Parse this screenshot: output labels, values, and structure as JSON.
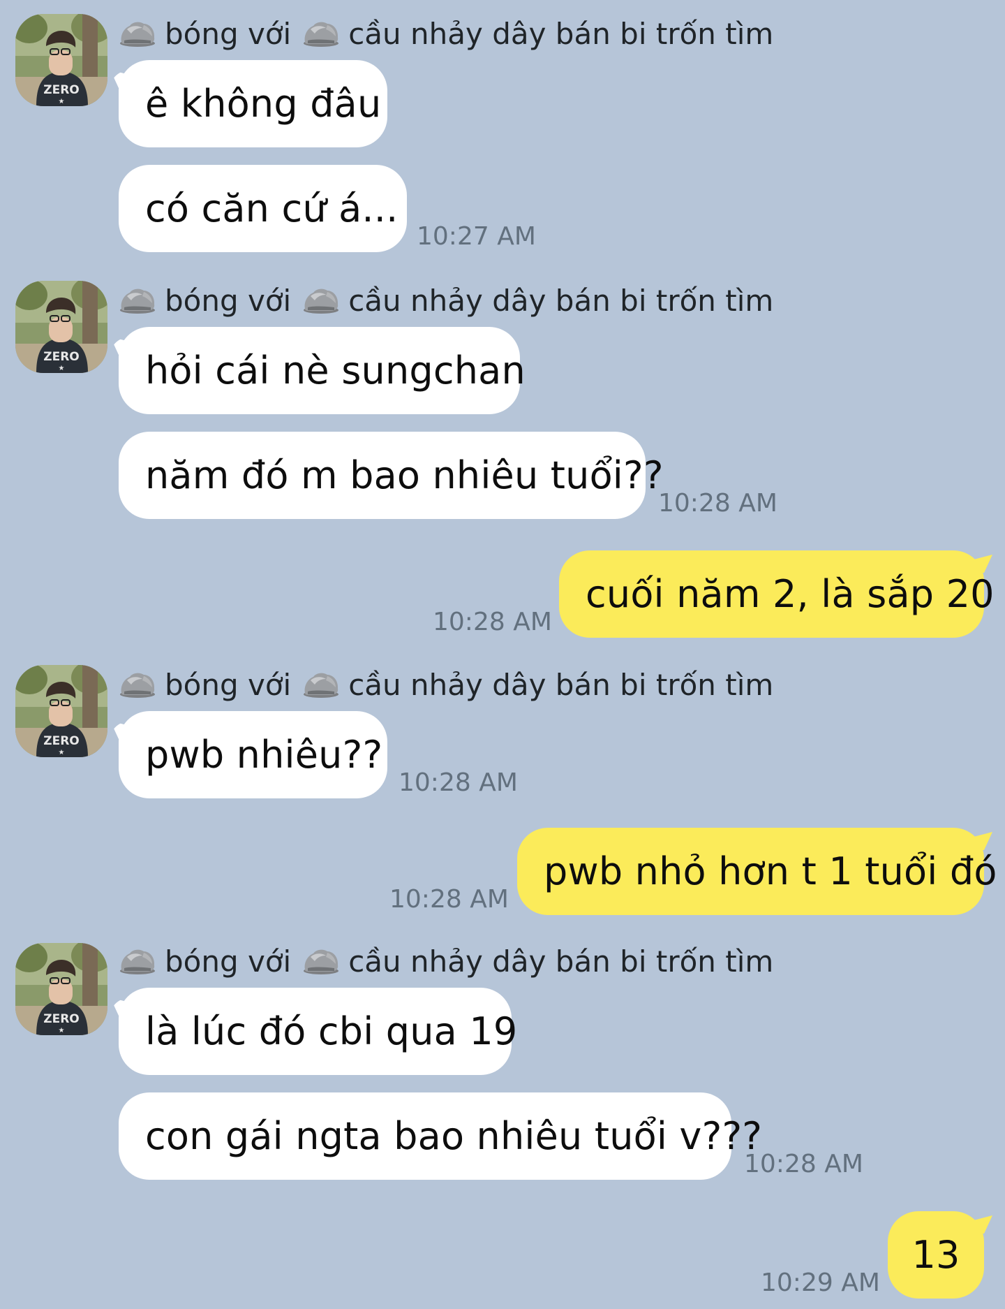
{
  "sender": {
    "part1": "bóng với",
    "part2": "cầu nhảy dây bán bi trốn tìm"
  },
  "messages": [
    {
      "text": "ê không đâu"
    },
    {
      "text": "có căn cứ á...",
      "time": "10:27 AM"
    },
    {
      "text": "hỏi cái nè sungchan"
    },
    {
      "text": "năm đó m bao nhiêu tuổi??",
      "time": "10:28 AM"
    },
    {
      "text": "cuối năm 2, là sắp 20",
      "time": "10:28 AM"
    },
    {
      "text": "pwb nhiêu??",
      "time": "10:28 AM"
    },
    {
      "text": "pwb nhỏ hơn t 1 tuổi đó",
      "time": "10:28 AM"
    },
    {
      "text": "là lúc đó cbi qua 19"
    },
    {
      "text": "con gái ngta bao nhiêu tuổi v???",
      "time": "10:28 AM"
    },
    {
      "text": "13",
      "time": "10:29 AM"
    }
  ],
  "colors": {
    "background": "#b6c5d8",
    "incoming_bubble": "#ffffff",
    "outgoing_bubble": "#fbeb5a",
    "timestamp": "#62707e"
  },
  "icons": {
    "sender_emoji": "rock-icon",
    "avatar": "profile-photo"
  }
}
